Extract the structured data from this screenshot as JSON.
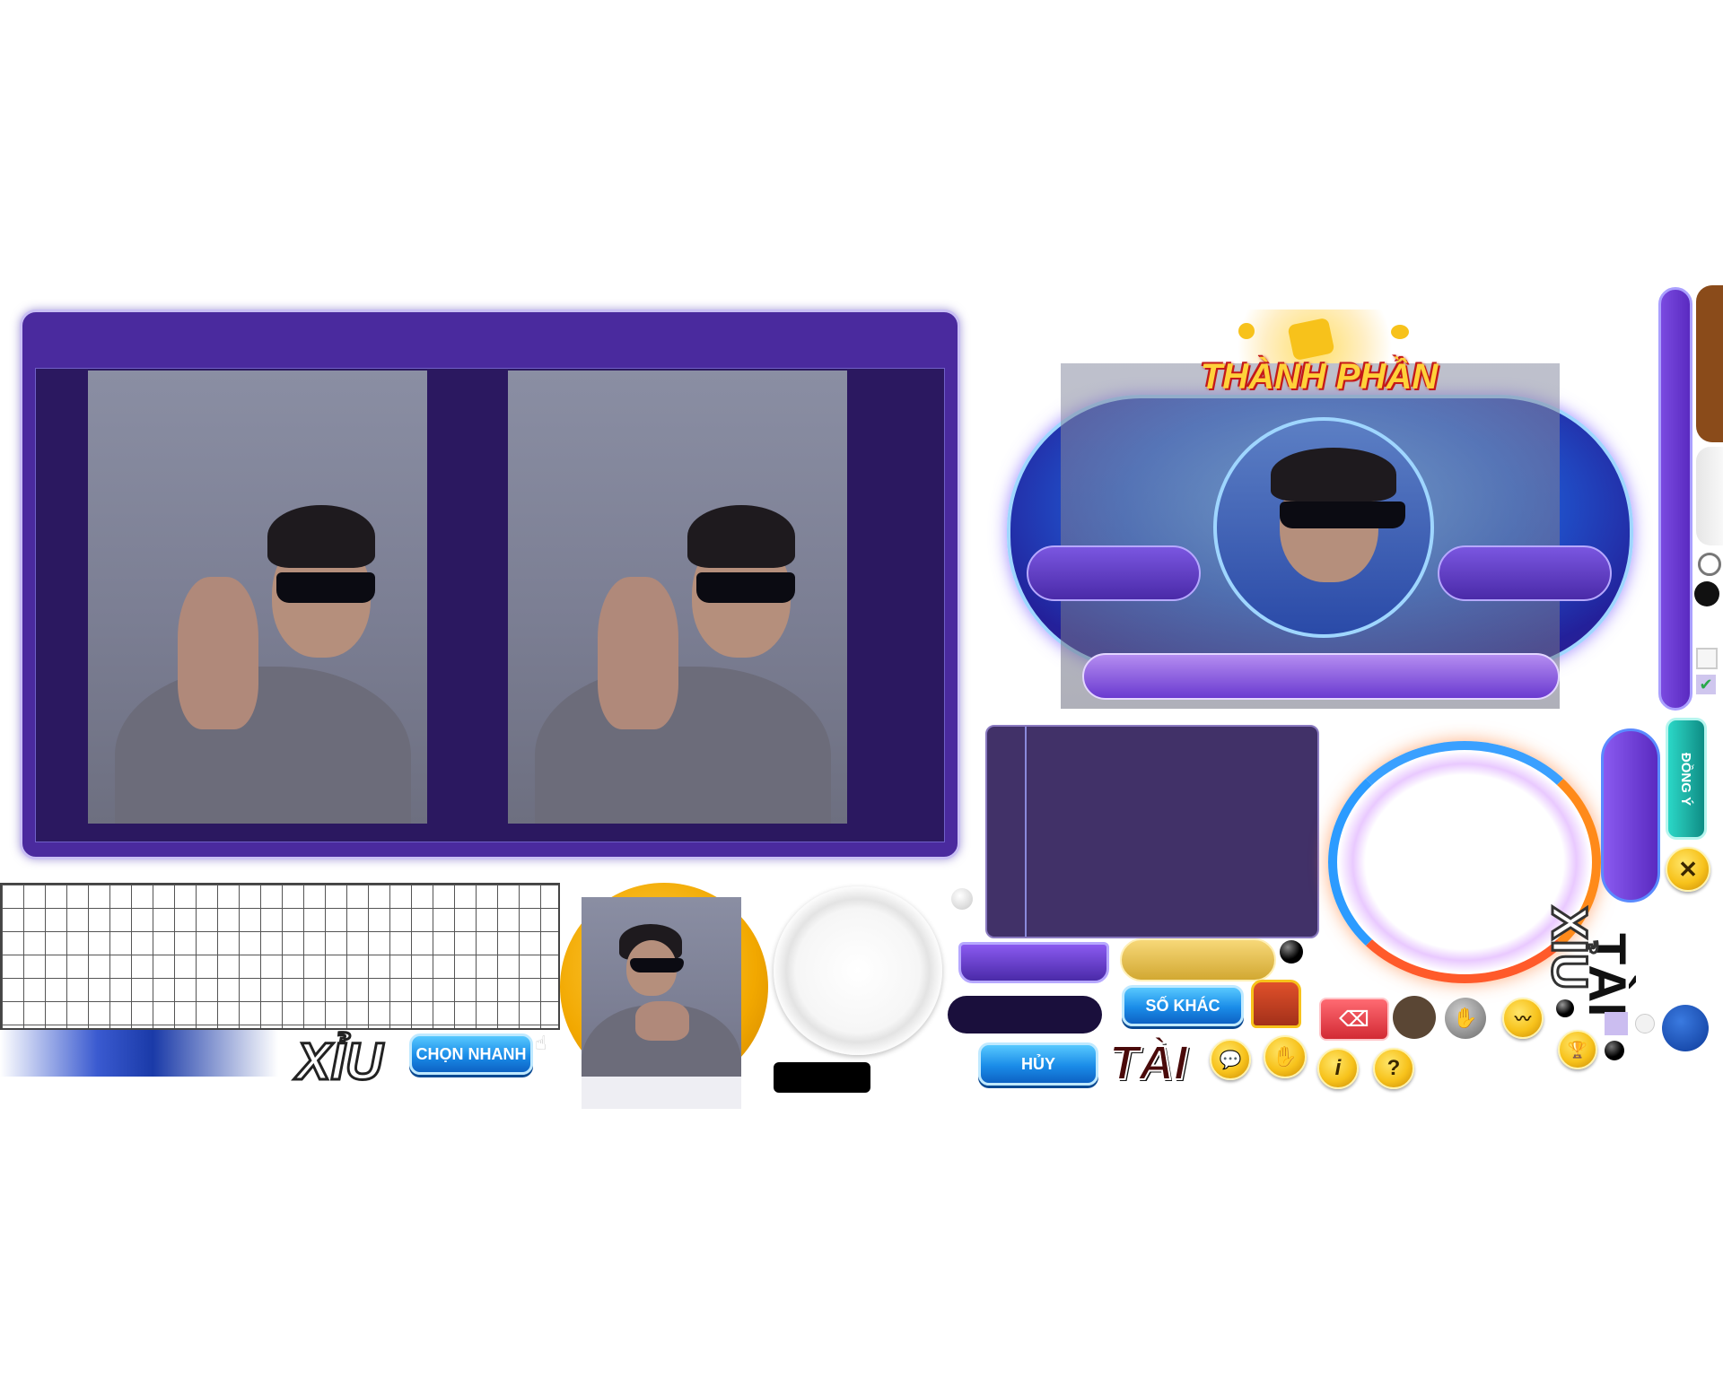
{
  "main_panel": {
    "frame_color": "#4a2a9e"
  },
  "avatar_frame": {
    "title": "THÀNH PHẦN"
  },
  "buttons": {
    "chon_nhanh": "CHỌN NHANH",
    "so_khac": "SỐ KHÁC",
    "huy": "HỦY",
    "dong_y": "ĐỒNG Ý",
    "close_symbol": "✕"
  },
  "labels": {
    "xiu": "XỈU",
    "tai": "TÀI",
    "tai_vertical": "TÀI",
    "xiu_vertical": "XỈU"
  },
  "icons": {
    "chat": "chat-icon",
    "hand": "hand-icon",
    "info": "i",
    "help": "?",
    "trophy": "trophy-icon",
    "chart": "chart-icon",
    "delete": "backspace-icon",
    "treasure": "treasure-icon"
  },
  "colors": {
    "purple": "#4a2a9e",
    "dark_purple": "#2b1860",
    "blue_accent": "#1a8ce8",
    "gold": "#f7c21b",
    "teal": "#1fb3a6",
    "brown": "#8a4b1a",
    "red_btn": "#e53b45"
  }
}
